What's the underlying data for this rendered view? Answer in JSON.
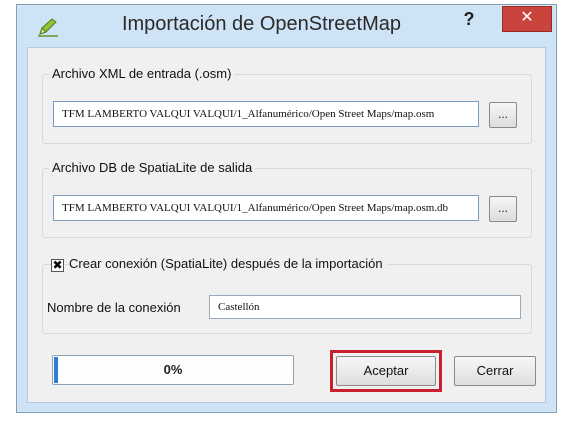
{
  "window": {
    "title": "Importación de OpenStreetMap",
    "help_label": "?",
    "close_label": "✕",
    "app_icon": "qgis-pencil-icon"
  },
  "input_group": {
    "legend": "Archivo XML de entrada (.osm)",
    "path": "TFM LAMBERTO VALQUI VALQUI/1_Alfanumérico/Open Street Maps/map.osm",
    "browse_label": "..."
  },
  "output_group": {
    "legend": "Archivo DB de SpatiaLite de salida",
    "path": "TFM LAMBERTO VALQUI VALQUI/1_Alfanumérico/Open Street Maps/map.osm.db",
    "browse_label": "..."
  },
  "connection_group": {
    "checkbox_mark": "✖",
    "checkbox_checked": true,
    "checkbox_label": "Crear conexión (SpatiaLite) después de la importación",
    "name_label": "Nombre de la conexión",
    "name_value": "Castellón"
  },
  "footer": {
    "progress_text": "0%",
    "progress_value": 0,
    "accept_label": "Aceptar",
    "close_label": "Cerrar"
  },
  "colors": {
    "window_frame": "#cfe3f6",
    "close_button": "#c9443d",
    "highlight": "#c8202f",
    "progress_fill": "#2d7fd6"
  }
}
